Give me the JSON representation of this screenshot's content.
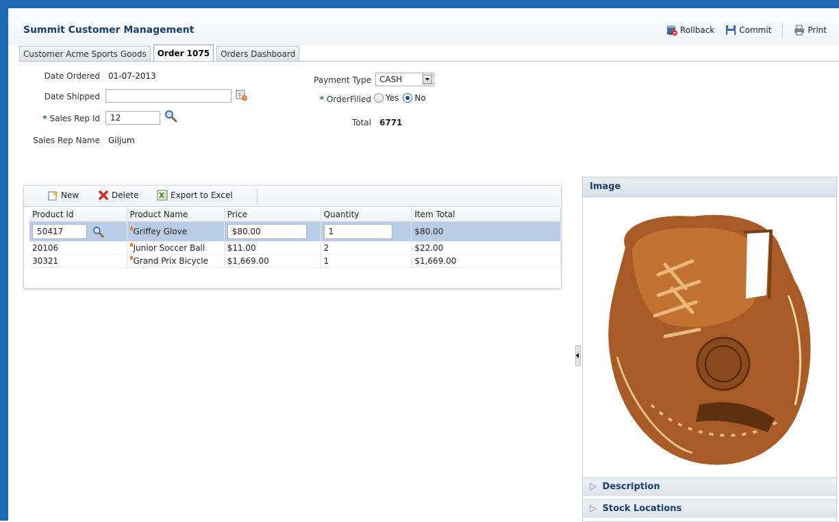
{
  "app": {
    "title": "Summit Customer Management"
  },
  "toolbar": {
    "rollback": "Rollback",
    "commit": "Commit",
    "print": "Print"
  },
  "tabs": [
    {
      "label": "Customer Acme Sports Goods",
      "active": false
    },
    {
      "label": "Order 1075",
      "active": true
    },
    {
      "label": "Orders Dashboard",
      "active": false
    }
  ],
  "form": {
    "date_ordered_label": "Date Ordered",
    "date_ordered_value": "01-07-2013",
    "date_shipped_label": "Date Shipped",
    "date_shipped_value": "",
    "sales_rep_id_label": "Sales Rep Id",
    "sales_rep_id_value": "12",
    "sales_rep_name_label": "Sales Rep Name",
    "sales_rep_name_value": "Giljum",
    "payment_type_label": "Payment Type",
    "payment_type_value": "CASH",
    "order_filled_label": "OrderFilled",
    "order_filled_yes": "Yes",
    "order_filled_no": "No",
    "order_filled_selected": "No",
    "total_label": "Total",
    "total_value": "6771",
    "required_mark": "*"
  },
  "grid": {
    "new_label": "New",
    "delete_label": "Delete",
    "export_label": "Export to Excel",
    "columns": [
      "Product Id",
      "Product Name",
      "Price",
      "Quantity",
      "Item Total"
    ],
    "rows": [
      {
        "product_id": "50417",
        "product_name": "Griffey Glove",
        "price": "$80.00",
        "quantity": "1",
        "item_total": "$80.00"
      },
      {
        "product_id": "20106",
        "product_name": "Junior Soccer Ball",
        "price": "$11.00",
        "quantity": "2",
        "item_total": "$22.00"
      },
      {
        "product_id": "30321",
        "product_name": "Grand Prix Bicycle",
        "price": "$1,669.00",
        "quantity": "1",
        "item_total": "$1,669.00"
      }
    ]
  },
  "right_panel": {
    "image_header": "Image",
    "description": "Description",
    "stock_locations": "Stock Locations"
  },
  "colors": {
    "frame": "#1f6ab5",
    "title": "#1b3f6b",
    "selected_row": "#b9cee6"
  }
}
